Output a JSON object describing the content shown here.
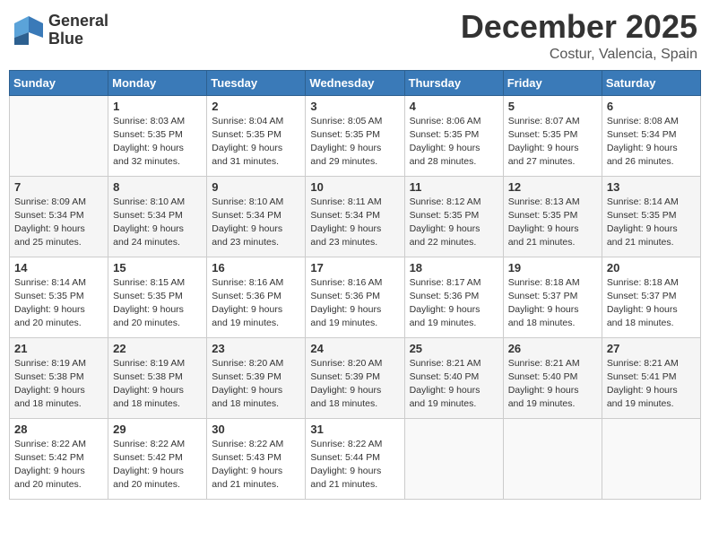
{
  "header": {
    "logo_line1": "General",
    "logo_line2": "Blue",
    "month": "December 2025",
    "location": "Costur, Valencia, Spain"
  },
  "days_of_week": [
    "Sunday",
    "Monday",
    "Tuesday",
    "Wednesday",
    "Thursday",
    "Friday",
    "Saturday"
  ],
  "weeks": [
    [
      {
        "day": "",
        "info": ""
      },
      {
        "day": "1",
        "info": "Sunrise: 8:03 AM\nSunset: 5:35 PM\nDaylight: 9 hours\nand 32 minutes."
      },
      {
        "day": "2",
        "info": "Sunrise: 8:04 AM\nSunset: 5:35 PM\nDaylight: 9 hours\nand 31 minutes."
      },
      {
        "day": "3",
        "info": "Sunrise: 8:05 AM\nSunset: 5:35 PM\nDaylight: 9 hours\nand 29 minutes."
      },
      {
        "day": "4",
        "info": "Sunrise: 8:06 AM\nSunset: 5:35 PM\nDaylight: 9 hours\nand 28 minutes."
      },
      {
        "day": "5",
        "info": "Sunrise: 8:07 AM\nSunset: 5:35 PM\nDaylight: 9 hours\nand 27 minutes."
      },
      {
        "day": "6",
        "info": "Sunrise: 8:08 AM\nSunset: 5:34 PM\nDaylight: 9 hours\nand 26 minutes."
      }
    ],
    [
      {
        "day": "7",
        "info": "Sunrise: 8:09 AM\nSunset: 5:34 PM\nDaylight: 9 hours\nand 25 minutes."
      },
      {
        "day": "8",
        "info": "Sunrise: 8:10 AM\nSunset: 5:34 PM\nDaylight: 9 hours\nand 24 minutes."
      },
      {
        "day": "9",
        "info": "Sunrise: 8:10 AM\nSunset: 5:34 PM\nDaylight: 9 hours\nand 23 minutes."
      },
      {
        "day": "10",
        "info": "Sunrise: 8:11 AM\nSunset: 5:34 PM\nDaylight: 9 hours\nand 23 minutes."
      },
      {
        "day": "11",
        "info": "Sunrise: 8:12 AM\nSunset: 5:35 PM\nDaylight: 9 hours\nand 22 minutes."
      },
      {
        "day": "12",
        "info": "Sunrise: 8:13 AM\nSunset: 5:35 PM\nDaylight: 9 hours\nand 21 minutes."
      },
      {
        "day": "13",
        "info": "Sunrise: 8:14 AM\nSunset: 5:35 PM\nDaylight: 9 hours\nand 21 minutes."
      }
    ],
    [
      {
        "day": "14",
        "info": "Sunrise: 8:14 AM\nSunset: 5:35 PM\nDaylight: 9 hours\nand 20 minutes."
      },
      {
        "day": "15",
        "info": "Sunrise: 8:15 AM\nSunset: 5:35 PM\nDaylight: 9 hours\nand 20 minutes."
      },
      {
        "day": "16",
        "info": "Sunrise: 8:16 AM\nSunset: 5:36 PM\nDaylight: 9 hours\nand 19 minutes."
      },
      {
        "day": "17",
        "info": "Sunrise: 8:16 AM\nSunset: 5:36 PM\nDaylight: 9 hours\nand 19 minutes."
      },
      {
        "day": "18",
        "info": "Sunrise: 8:17 AM\nSunset: 5:36 PM\nDaylight: 9 hours\nand 19 minutes."
      },
      {
        "day": "19",
        "info": "Sunrise: 8:18 AM\nSunset: 5:37 PM\nDaylight: 9 hours\nand 18 minutes."
      },
      {
        "day": "20",
        "info": "Sunrise: 8:18 AM\nSunset: 5:37 PM\nDaylight: 9 hours\nand 18 minutes."
      }
    ],
    [
      {
        "day": "21",
        "info": "Sunrise: 8:19 AM\nSunset: 5:38 PM\nDaylight: 9 hours\nand 18 minutes."
      },
      {
        "day": "22",
        "info": "Sunrise: 8:19 AM\nSunset: 5:38 PM\nDaylight: 9 hours\nand 18 minutes."
      },
      {
        "day": "23",
        "info": "Sunrise: 8:20 AM\nSunset: 5:39 PM\nDaylight: 9 hours\nand 18 minutes."
      },
      {
        "day": "24",
        "info": "Sunrise: 8:20 AM\nSunset: 5:39 PM\nDaylight: 9 hours\nand 18 minutes."
      },
      {
        "day": "25",
        "info": "Sunrise: 8:21 AM\nSunset: 5:40 PM\nDaylight: 9 hours\nand 19 minutes."
      },
      {
        "day": "26",
        "info": "Sunrise: 8:21 AM\nSunset: 5:40 PM\nDaylight: 9 hours\nand 19 minutes."
      },
      {
        "day": "27",
        "info": "Sunrise: 8:21 AM\nSunset: 5:41 PM\nDaylight: 9 hours\nand 19 minutes."
      }
    ],
    [
      {
        "day": "28",
        "info": "Sunrise: 8:22 AM\nSunset: 5:42 PM\nDaylight: 9 hours\nand 20 minutes."
      },
      {
        "day": "29",
        "info": "Sunrise: 8:22 AM\nSunset: 5:42 PM\nDaylight: 9 hours\nand 20 minutes."
      },
      {
        "day": "30",
        "info": "Sunrise: 8:22 AM\nSunset: 5:43 PM\nDaylight: 9 hours\nand 21 minutes."
      },
      {
        "day": "31",
        "info": "Sunrise: 8:22 AM\nSunset: 5:44 PM\nDaylight: 9 hours\nand 21 minutes."
      },
      {
        "day": "",
        "info": ""
      },
      {
        "day": "",
        "info": ""
      },
      {
        "day": "",
        "info": ""
      }
    ]
  ]
}
